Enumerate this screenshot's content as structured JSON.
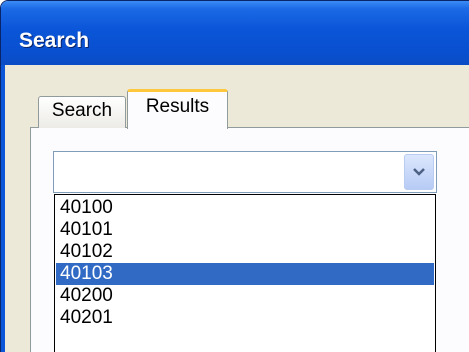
{
  "window": {
    "title": "Search"
  },
  "tabs": [
    {
      "label": "Search",
      "active": false
    },
    {
      "label": "Results",
      "active": true
    }
  ],
  "combo": {
    "value": "",
    "icon": "chevron-down-icon"
  },
  "dropdown": {
    "options": [
      "40100",
      "40101",
      "40102",
      "40103",
      "40200",
      "40201"
    ],
    "selected": "40103"
  },
  "colors": {
    "titlebar": "#0a55d8",
    "selection": "#316ac5",
    "tab_highlight": "#ffc83c",
    "dialog_bg": "#ece9d8"
  }
}
